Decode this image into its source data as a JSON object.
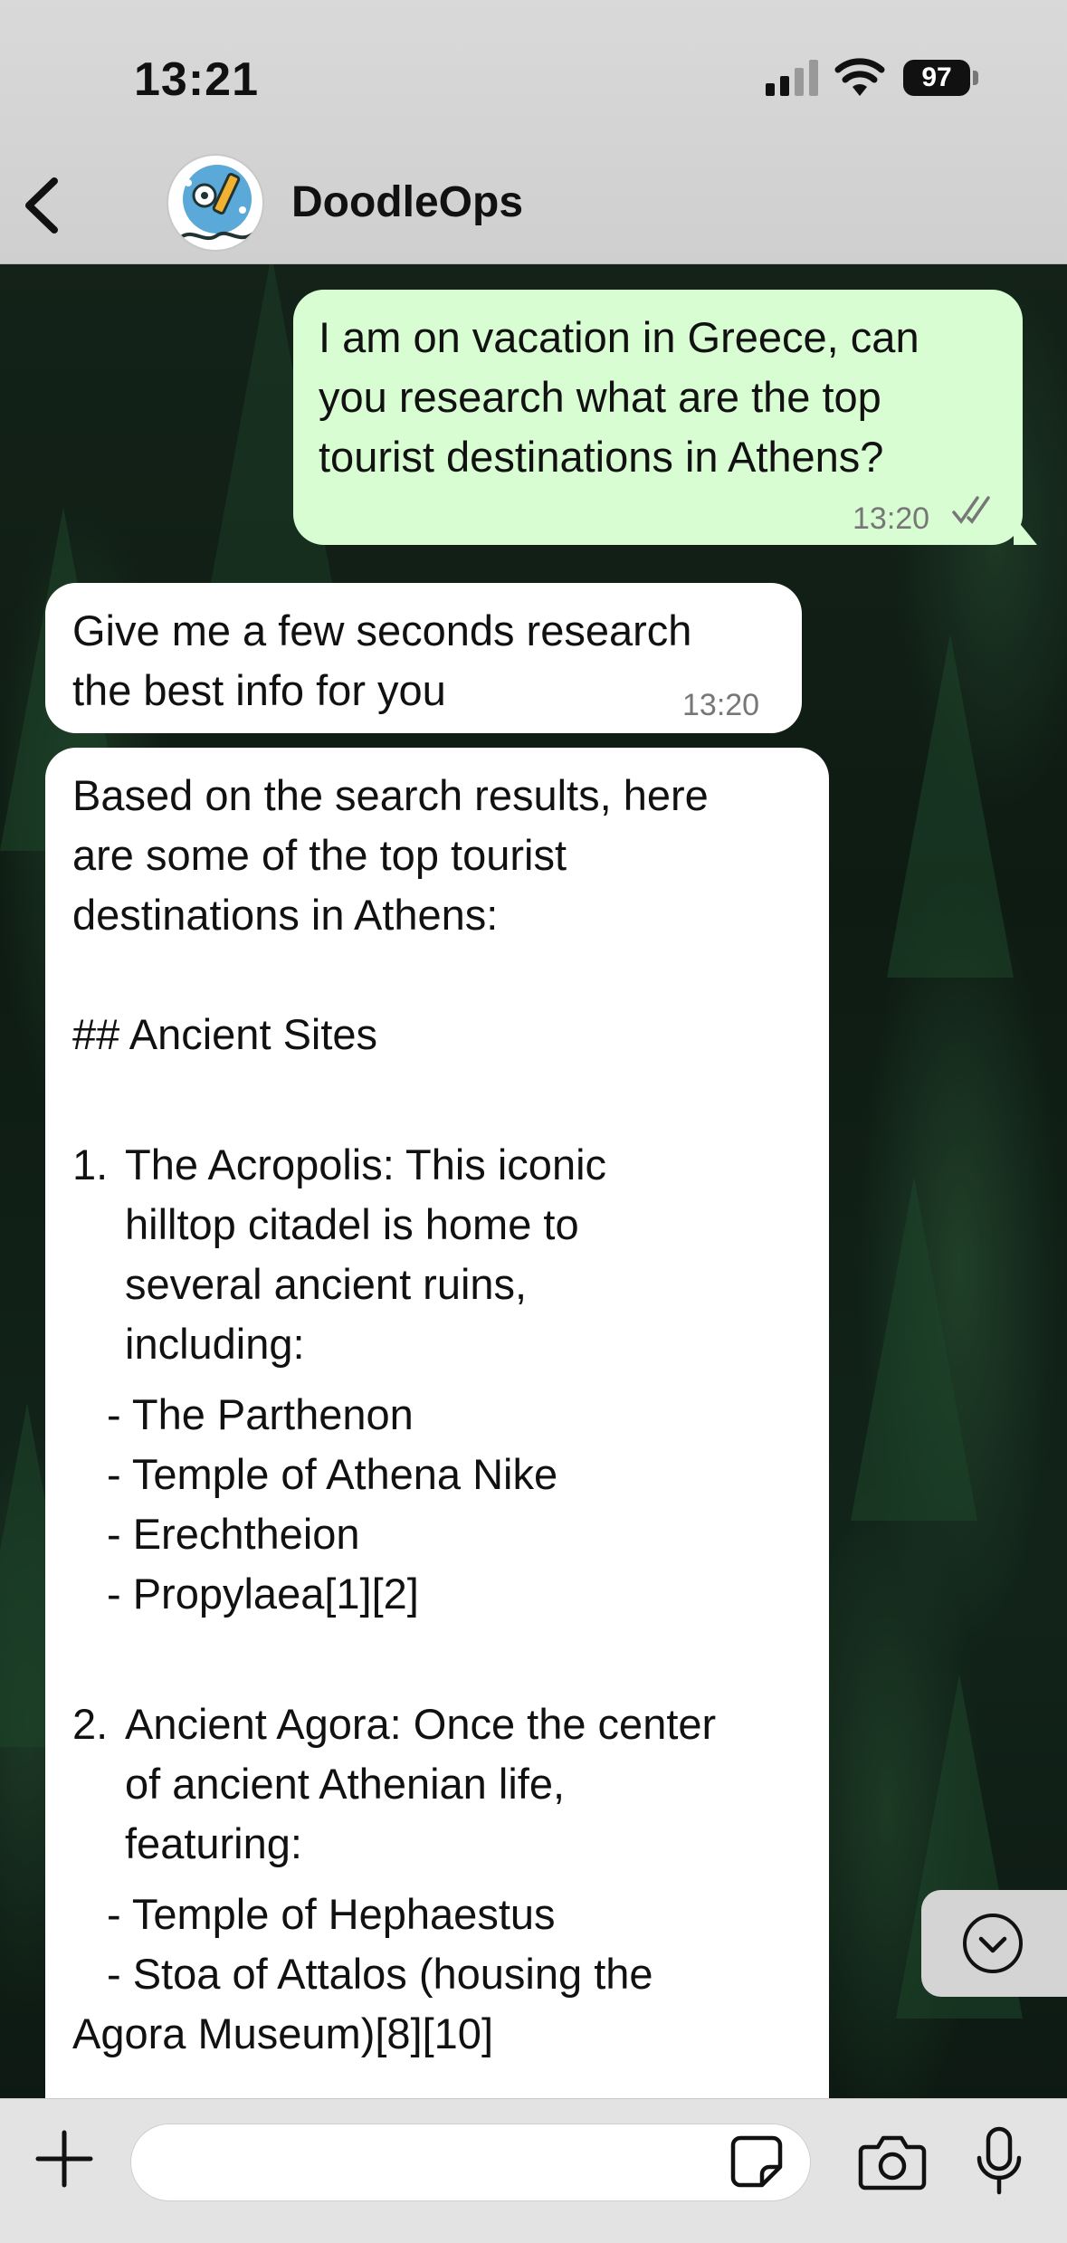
{
  "status_bar": {
    "time": "13:21",
    "battery": "97"
  },
  "header": {
    "contact_name": "DoodleOps"
  },
  "messages": {
    "outgoing_1": {
      "lines": [
        "I am on vacation in Greece, can",
        "you research what are the top",
        "tourist destinations in Athens?"
      ],
      "time": "13:20"
    },
    "incoming_1": {
      "lines": [
        "Give me a few seconds research",
        "the best info for you"
      ],
      "time": "13:20"
    },
    "incoming_2": {
      "intro": [
        "Based on the search results, here",
        "are some of the top tourist",
        "destinations in Athens:"
      ],
      "heading": "## Ancient Sites",
      "item1_num": "1.",
      "item1_lines": [
        "The Acropolis: This iconic",
        "hilltop citadel is home to",
        "several ancient ruins,",
        "including:"
      ],
      "item1_sub": [
        "- The Parthenon",
        "- Temple of Athena Nike",
        "- Erechtheion",
        "- Propylaea[1][2]"
      ],
      "item2_num": "2.",
      "item2_lines": [
        "Ancient Agora: Once the center",
        "of ancient Athenian life,",
        "featuring:"
      ],
      "item2_sub": [
        "- Temple of Hephaestus",
        "- Stoa of Attalos (housing the"
      ],
      "item2_tail": "Agora Museum)[8][10]"
    }
  },
  "icons": {
    "back": "chevron-left-icon",
    "scroll": "chevron-down-circle-icon",
    "plus": "plus-icon",
    "sticker": "sticker-icon",
    "camera": "camera-icon",
    "mic": "microphone-icon"
  },
  "colors": {
    "outgoing_bubble": "#d9fdd3",
    "incoming_bubble": "#ffffff",
    "read_ticks": "#777777"
  }
}
